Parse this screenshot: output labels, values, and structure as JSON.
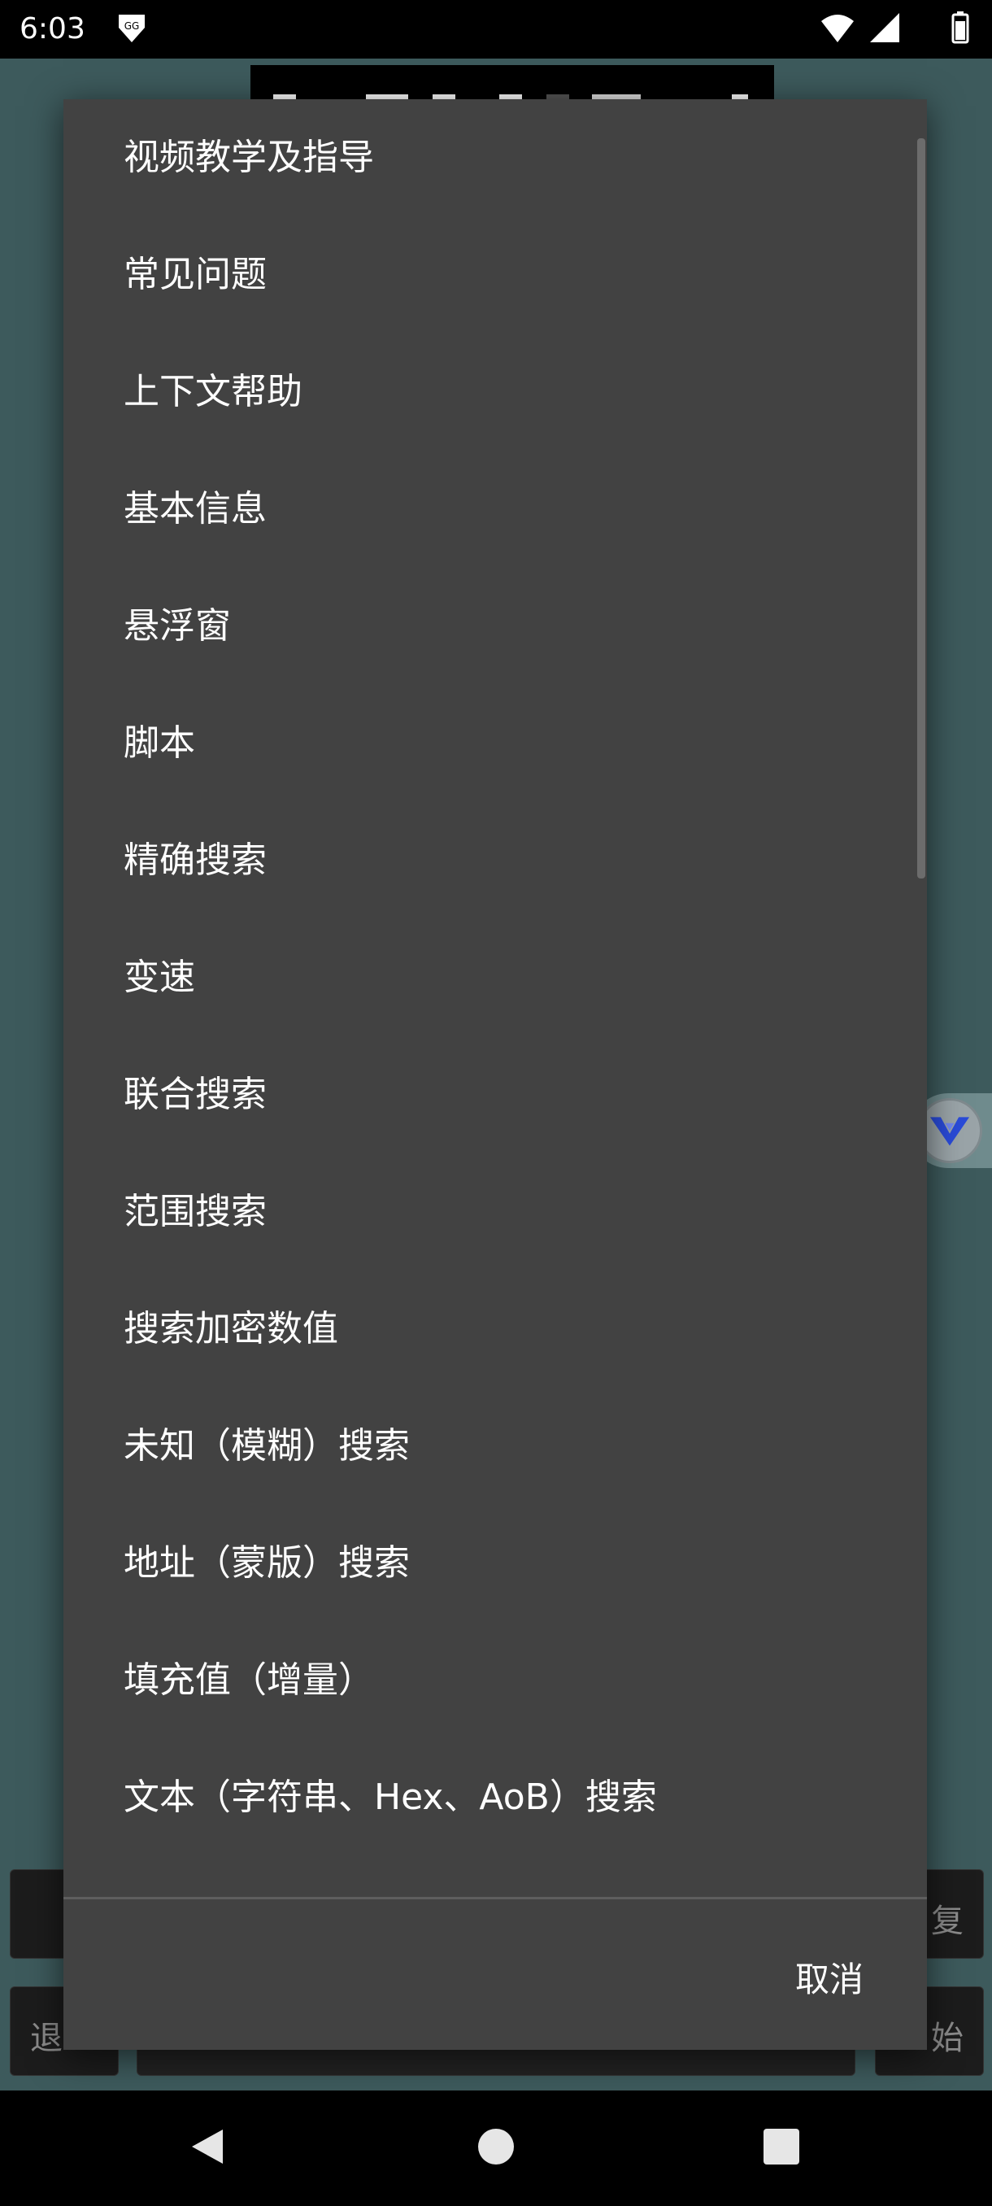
{
  "status_bar": {
    "time": "6:03",
    "app_icon": "gg-icon",
    "icons": [
      "wifi-icon",
      "signal-icon",
      "battery-icon"
    ]
  },
  "background": {
    "right_top_button_char": "复",
    "right_bottom_button_char": "始",
    "left_bottom_button_char": "退"
  },
  "dialog": {
    "items": [
      "视频教学及指导",
      "常见问题",
      "上下文帮助",
      "基本信息",
      "悬浮窗",
      "脚本",
      "精确搜索",
      "变速",
      "联合搜索",
      "范围搜索",
      "搜索加密数值",
      "未知（模糊）搜索",
      "地址（蒙版）搜索",
      "填充值（增量）",
      "文本（字符串、Hex、AoB）搜索"
    ],
    "cancel_label": "取消"
  },
  "floating_button": {
    "icon": "v-logo-icon"
  },
  "nav_bar": {
    "icons": [
      "back-icon",
      "home-icon",
      "recents-icon"
    ]
  },
  "colors": {
    "background": "#3d5a5c",
    "dialog": "#424242",
    "text": "#ffffff",
    "accent_logo": "#2a4bd8"
  }
}
